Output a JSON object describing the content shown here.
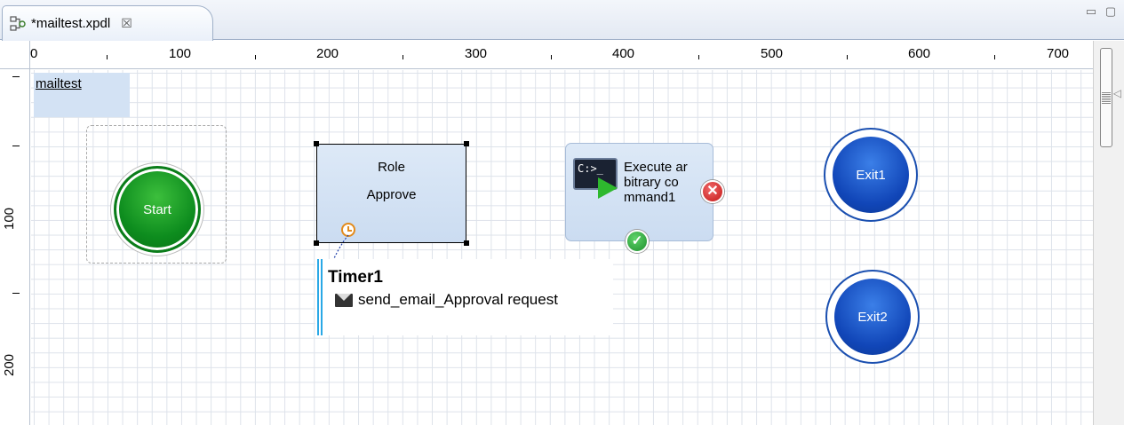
{
  "tab": {
    "title": "*mailtest.xpdl",
    "icon": "process-diagram-icon",
    "close_icon": "close-icon"
  },
  "window_controls": {
    "minimize": "minimize-icon",
    "maximize": "maximize-icon"
  },
  "rulers": {
    "horizontal_labels": [
      "0",
      "100",
      "200",
      "300",
      "400",
      "500",
      "600",
      "700"
    ],
    "vertical_labels": [
      "100",
      "200"
    ]
  },
  "diagram": {
    "pool_name": "mailtest",
    "start_event": {
      "label": "Start",
      "color": "#0d8c1e"
    },
    "role_task": {
      "line1": "Role",
      "line2": "Approve"
    },
    "exec_task": {
      "label_lines": [
        "Execute ar",
        "bitrary co",
        "mmand1"
      ],
      "icon": "command-line-icon",
      "prompt": "C:>_"
    },
    "end_events": [
      {
        "label": "Exit1",
        "color": "#1146b8"
      },
      {
        "label": "Exit2",
        "color": "#1146b8"
      }
    ],
    "timer": {
      "title": "Timer1",
      "action": "send_email_Approval request",
      "icon": "mail-icon"
    }
  }
}
